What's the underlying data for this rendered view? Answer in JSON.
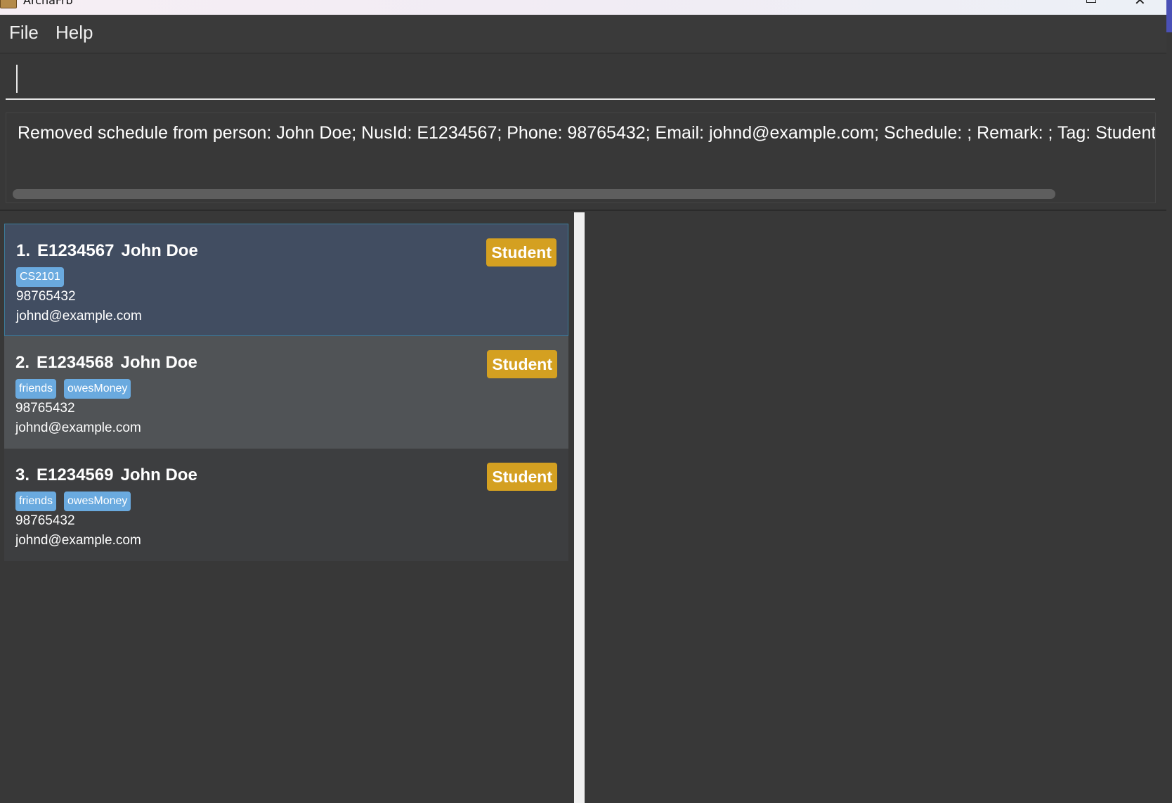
{
  "window": {
    "title": "ArchaFrb",
    "accent_color": "#4a50b5"
  },
  "menu": {
    "items": [
      "File",
      "Help"
    ]
  },
  "command": {
    "value": ""
  },
  "result": {
    "text": "Removed schedule from person: John Doe; NusId: E1234567; Phone: 98765432; Email: johnd@example.com; Schedule: ; Remark: ; Tag: Student; Grou"
  },
  "persons": [
    {
      "index": "1.",
      "nusid": "E1234567",
      "name": "John Doe",
      "role": "Student",
      "groups": [
        "CS2101"
      ],
      "phone": "98765432",
      "email": "johnd@example.com"
    },
    {
      "index": "2.",
      "nusid": "E1234568",
      "name": "John Doe",
      "role": "Student",
      "groups": [
        "friends",
        "owesMoney"
      ],
      "phone": "98765432",
      "email": "johnd@example.com"
    },
    {
      "index": "3.",
      "nusid": "E1234569",
      "name": "John Doe",
      "role": "Student",
      "groups": [
        "friends",
        "owesMoney"
      ],
      "phone": "98765432",
      "email": "johnd@example.com"
    }
  ],
  "colors": {
    "role_badge": "#d4a021",
    "group_tag": "#6aaadf",
    "selected_card": "#414d61"
  }
}
